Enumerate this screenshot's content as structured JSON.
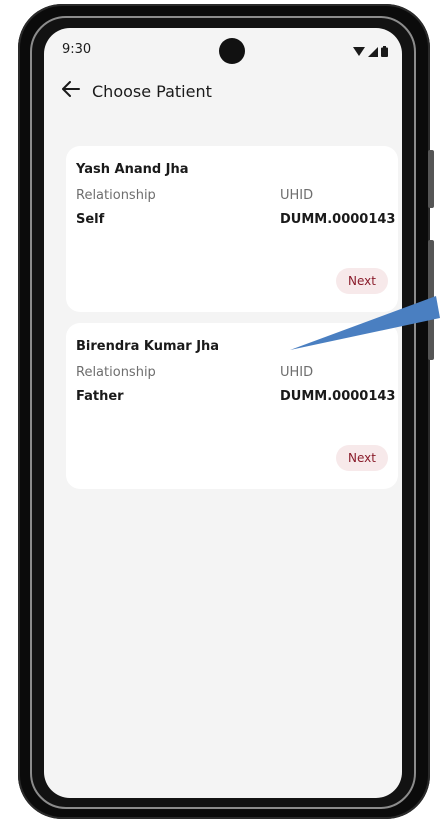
{
  "status_bar": {
    "time": "9:30",
    "icons": [
      "wifi-icon",
      "signal-icon",
      "battery-icon"
    ]
  },
  "appbar": {
    "back_icon": "arrow-left-icon",
    "title": "Choose Patient"
  },
  "patients": [
    {
      "name": "Yash Anand Jha",
      "relationship_label": "Relationship",
      "relationship": "Self",
      "uhid_label": "UHID",
      "uhid": "DUMM.0000143",
      "next_label": "Next"
    },
    {
      "name": "Birendra Kumar Jha",
      "relationship_label": "Relationship",
      "relationship": "Father",
      "uhid_label": "UHID",
      "uhid": "DUMM.0000143",
      "next_label": "Next"
    }
  ],
  "colors": {
    "screen_bg": "#f4f4f4",
    "card_bg": "#ffffff",
    "accent": "#8a1c2b",
    "button_bg": "#f7e9ea",
    "annotation_arrow": "#4a7fc1"
  }
}
